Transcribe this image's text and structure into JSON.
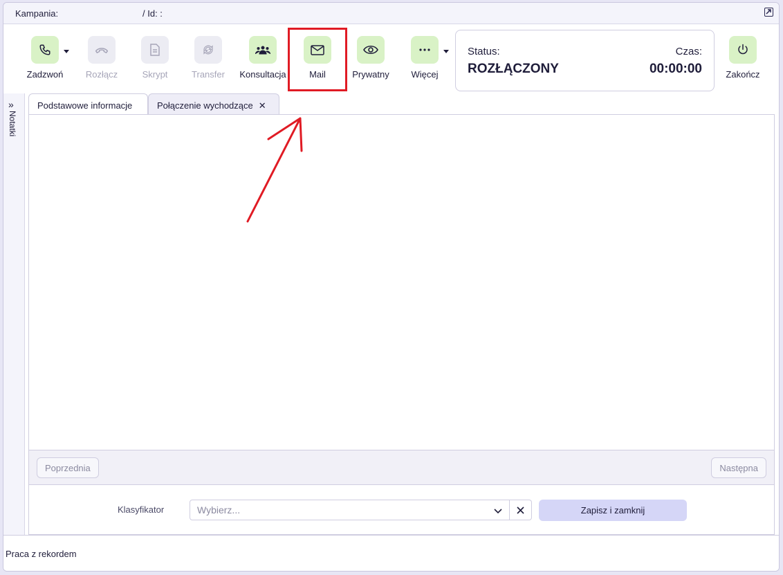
{
  "topbar": {
    "campaign_label": "Kampania:",
    "id_label": "/ Id: :"
  },
  "toolbar": {
    "call": "Zadzwoń",
    "hangup": "Rozłącz",
    "script": "Skrypt",
    "transfer": "Transfer",
    "consult": "Konsultacja",
    "mail": "Mail",
    "private": "Prywatny",
    "more": "Więcej",
    "finish": "Zakończ"
  },
  "status": {
    "status_label": "Status:",
    "status_value": "ROZŁĄCZONY",
    "time_label": "Czas:",
    "time_value": "00:00:00"
  },
  "notes": {
    "label": "Notatki"
  },
  "tabs": [
    {
      "label": "Podstawowe informacje"
    },
    {
      "label": "Połączenie wychodzące"
    }
  ],
  "nav": {
    "prev": "Poprzednia",
    "next": "Następna"
  },
  "classifier": {
    "label": "Klasyfikator",
    "placeholder": "Wybierz...",
    "save": "Zapisz i zamknij"
  },
  "footer": {
    "text": "Praca z rekordem"
  },
  "colors": {
    "accent_green": "#d9f2c6",
    "highlight_red": "#e01b24",
    "save_button": "#d5d6f7"
  }
}
